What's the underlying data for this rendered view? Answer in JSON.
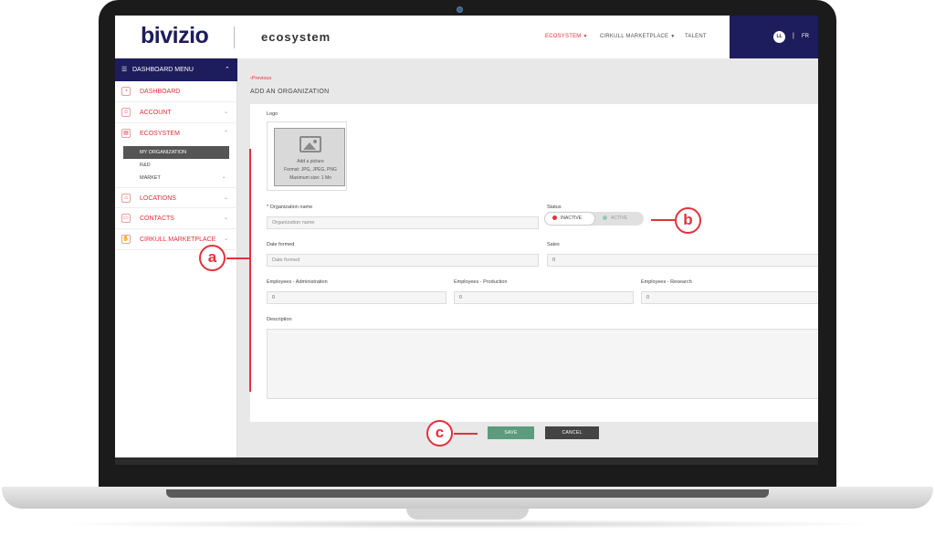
{
  "header": {
    "logo_text": "bivizio",
    "app_title": "ecosystem",
    "nav": [
      {
        "label": "ECOSYSTEM",
        "active": true
      },
      {
        "label": "CIRKULL MARKETPLACE",
        "active": false
      },
      {
        "label": "TALENT",
        "active": false
      }
    ],
    "user_initials": "LL",
    "separator": "|",
    "language": "FR"
  },
  "sidebar": {
    "menu_title": "DASHBOARD MENU",
    "items": {
      "dashboard": "DASHBOARD",
      "account": "ACCOUNT",
      "ecosystem": "ECOSYSTEM",
      "locations": "LOCATIONS",
      "contacts": "CONTACTS",
      "cirkull_marketplace": "CIRKULL MARKETPLACE"
    },
    "subitems": {
      "my_organization": "MY ORGANIZATION",
      "rd": "R&D",
      "market": "MARKET"
    }
  },
  "main": {
    "previous_link": "Previous",
    "page_title": "ADD AN ORGANIZATION",
    "logo": {
      "label": "Logo",
      "add_text": "Add a picture",
      "format_text": "Format: JPG, JPEG, PNG",
      "size_text": "Maximum size: 1 Mo"
    },
    "org_name": {
      "label": "* Organization name",
      "placeholder": "Organization name"
    },
    "status": {
      "label": "Status",
      "inactive": "INACTIVE",
      "active": "ACTIVE",
      "selected": "INACTIVE"
    },
    "date_formed": {
      "label": "Date formed",
      "placeholder": "Date formed"
    },
    "sales": {
      "label": "Sales",
      "value": "0"
    },
    "emp_admin": {
      "label": "Employees - Administration",
      "value": "0"
    },
    "emp_prod": {
      "label": "Employees - Production",
      "value": "0"
    },
    "emp_research": {
      "label": "Employees - Research",
      "value": "0"
    },
    "description": {
      "label": "Description"
    }
  },
  "actions": {
    "save": "SAVE",
    "cancel": "CANCEL"
  },
  "annotations": {
    "a": "a",
    "b": "b",
    "c": "c"
  },
  "colors": {
    "brand_navy": "#1d1c5c",
    "accent_red": "#e2313b",
    "save_green": "#5c9c7c",
    "cancel_dark": "#444444"
  },
  "icons": {
    "dashboard": "dashboard-icon",
    "account": "account-icon",
    "ecosystem": "ecosystem-icon",
    "locations": "locations-icon",
    "contacts": "contacts-icon",
    "marketplace": "handshake-icon",
    "menu": "hamburger-icon",
    "picture": "picture-icon"
  }
}
